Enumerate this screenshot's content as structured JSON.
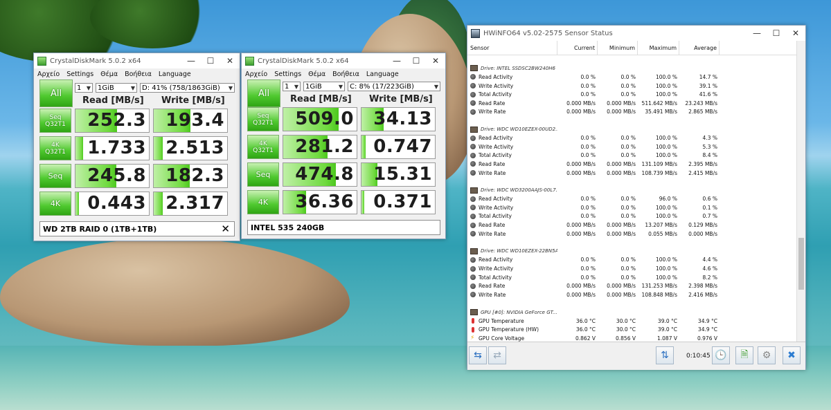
{
  "cdm1": {
    "title": "CrystalDiskMark 5.0.2 x64",
    "menu": [
      "Αρχείο",
      "Settings",
      "Θέμα",
      "Βοήθεια",
      "Language"
    ],
    "all_label": "All",
    "count": "1",
    "size": "1GiB",
    "drive": "D: 41% (758/1863GiB)",
    "read_header": "Read [MB/s]",
    "write_header": "Write [MB/s]",
    "rows": [
      {
        "l1": "Seq",
        "l2": "Q32T1",
        "read": "252.3",
        "write": "193.4",
        "read_fill": 0.57,
        "write_fill": 0.5
      },
      {
        "l1": "4K",
        "l2": "Q32T1",
        "read": "1.733",
        "write": "2.513",
        "read_fill": 0.1,
        "write_fill": 0.12
      },
      {
        "l1": "Seq",
        "l2": "",
        "read": "245.8",
        "write": "182.3",
        "read_fill": 0.56,
        "write_fill": 0.49
      },
      {
        "l1": "4K",
        "l2": "",
        "read": "0.443",
        "write": "2.317",
        "read_fill": 0.05,
        "write_fill": 0.12
      }
    ],
    "comment": "WD 2TB RAID 0 (1TB+1TB)"
  },
  "cdm2": {
    "title": "CrystalDiskMark 5.0.2 x64",
    "menu": [
      "Αρχείο",
      "Settings",
      "Θέμα",
      "Βοήθεια",
      "Language"
    ],
    "all_label": "All",
    "count": "1",
    "size": "1GiB",
    "drive": "C: 8% (17/223GiB)",
    "read_header": "Read [MB/s]",
    "write_header": "Write [MB/s]",
    "rows": [
      {
        "l1": "Seq",
        "l2": "Q32T1",
        "read": "509.0",
        "write": "34.13",
        "read_fill": 0.75,
        "write_fill": 0.3
      },
      {
        "l1": "4K",
        "l2": "Q32T1",
        "read": "281.2",
        "write": "0.747",
        "read_fill": 0.6,
        "write_fill": 0.06
      },
      {
        "l1": "Seq",
        "l2": "",
        "read": "474.8",
        "write": "15.31",
        "read_fill": 0.72,
        "write_fill": 0.22
      },
      {
        "l1": "4K",
        "l2": "",
        "read": "36.36",
        "write": "0.371",
        "read_fill": 0.31,
        "write_fill": 0.04
      }
    ],
    "comment": "INTEL 535 240GB"
  },
  "hwinfo": {
    "title": "HWiNFO64 v5.02-2575 Sensor Status",
    "columns": [
      "Sensor",
      "Current",
      "Minimum",
      "Maximum",
      "Average"
    ],
    "groups": [
      {
        "name": "Drive: INTEL SSDSC2BW240H6",
        "icon": "drive-icon",
        "rows": [
          {
            "n": "Read Activity",
            "cur": "0.0 %",
            "min": "0.0 %",
            "max": "100.0 %",
            "avg": "14.7 %"
          },
          {
            "n": "Write Activity",
            "cur": "0.0 %",
            "min": "0.0 %",
            "max": "100.0 %",
            "avg": "39.1 %"
          },
          {
            "n": "Total Activity",
            "cur": "0.0 %",
            "min": "0.0 %",
            "max": "100.0 %",
            "avg": "41.6 %"
          },
          {
            "n": "Read Rate",
            "cur": "0.000 MB/s",
            "min": "0.000 MB/s",
            "max": "511.642 MB/s",
            "avg": "23.243 MB/s"
          },
          {
            "n": "Write Rate",
            "cur": "0.000 MB/s",
            "min": "0.000 MB/s",
            "max": "35.491 MB/s",
            "avg": "2.865 MB/s"
          }
        ]
      },
      {
        "name": "Drive: WDC WD10EZEX-00UD2...",
        "icon": "drive-icon",
        "rows": [
          {
            "n": "Read Activity",
            "cur": "0.0 %",
            "min": "0.0 %",
            "max": "100.0 %",
            "avg": "4.3 %"
          },
          {
            "n": "Write Activity",
            "cur": "0.0 %",
            "min": "0.0 %",
            "max": "100.0 %",
            "avg": "5.3 %"
          },
          {
            "n": "Total Activity",
            "cur": "0.0 %",
            "min": "0.0 %",
            "max": "100.0 %",
            "avg": "8.4 %"
          },
          {
            "n": "Read Rate",
            "cur": "0.000 MB/s",
            "min": "0.000 MB/s",
            "max": "131.109 MB/s",
            "avg": "2.395 MB/s"
          },
          {
            "n": "Write Rate",
            "cur": "0.000 MB/s",
            "min": "0.000 MB/s",
            "max": "108.739 MB/s",
            "avg": "2.415 MB/s"
          }
        ]
      },
      {
        "name": "Drive: WDC WD3200AAJS-00L7...",
        "icon": "drive-icon",
        "rows": [
          {
            "n": "Read Activity",
            "cur": "0.0 %",
            "min": "0.0 %",
            "max": "96.0 %",
            "avg": "0.6 %"
          },
          {
            "n": "Write Activity",
            "cur": "0.0 %",
            "min": "0.0 %",
            "max": "100.0 %",
            "avg": "0.1 %"
          },
          {
            "n": "Total Activity",
            "cur": "0.0 %",
            "min": "0.0 %",
            "max": "100.0 %",
            "avg": "0.7 %"
          },
          {
            "n": "Read Rate",
            "cur": "0.000 MB/s",
            "min": "0.000 MB/s",
            "max": "13.207 MB/s",
            "avg": "0.129 MB/s"
          },
          {
            "n": "Write Rate",
            "cur": "0.000 MB/s",
            "min": "0.000 MB/s",
            "max": "0.055 MB/s",
            "avg": "0.000 MB/s"
          }
        ]
      },
      {
        "name": "Drive: WDC WD10EZEX-22BN5A0...",
        "icon": "drive-icon",
        "rows": [
          {
            "n": "Read Activity",
            "cur": "0.0 %",
            "min": "0.0 %",
            "max": "100.0 %",
            "avg": "4.4 %"
          },
          {
            "n": "Write Activity",
            "cur": "0.0 %",
            "min": "0.0 %",
            "max": "100.0 %",
            "avg": "4.6 %"
          },
          {
            "n": "Total Activity",
            "cur": "0.0 %",
            "min": "0.0 %",
            "max": "100.0 %",
            "avg": "8.2 %"
          },
          {
            "n": "Read Rate",
            "cur": "0.000 MB/s",
            "min": "0.000 MB/s",
            "max": "131.253 MB/s",
            "avg": "2.398 MB/s"
          },
          {
            "n": "Write Rate",
            "cur": "0.000 MB/s",
            "min": "0.000 MB/s",
            "max": "108.848 MB/s",
            "avg": "2.416 MB/s"
          }
        ]
      },
      {
        "name": "GPU [#0]: NVIDIA GeForce GT...",
        "icon": "gpu-icon",
        "rows": [
          {
            "n": "GPU Temperature",
            "cur": "36.0 °C",
            "min": "30.0 °C",
            "max": "39.0 °C",
            "avg": "34.9 °C",
            "icon": "thermometer-icon"
          },
          {
            "n": "GPU Temperature (HW)",
            "cur": "36.0 °C",
            "min": "30.0 °C",
            "max": "39.0 °C",
            "avg": "34.9 °C",
            "icon": "thermometer-icon"
          },
          {
            "n": "GPU Core Voltage",
            "cur": "0.862 V",
            "min": "0.856 V",
            "max": "1.087 V",
            "avg": "0.976 V",
            "icon": "voltage-icon"
          }
        ]
      }
    ],
    "timer": "0:10:45"
  }
}
